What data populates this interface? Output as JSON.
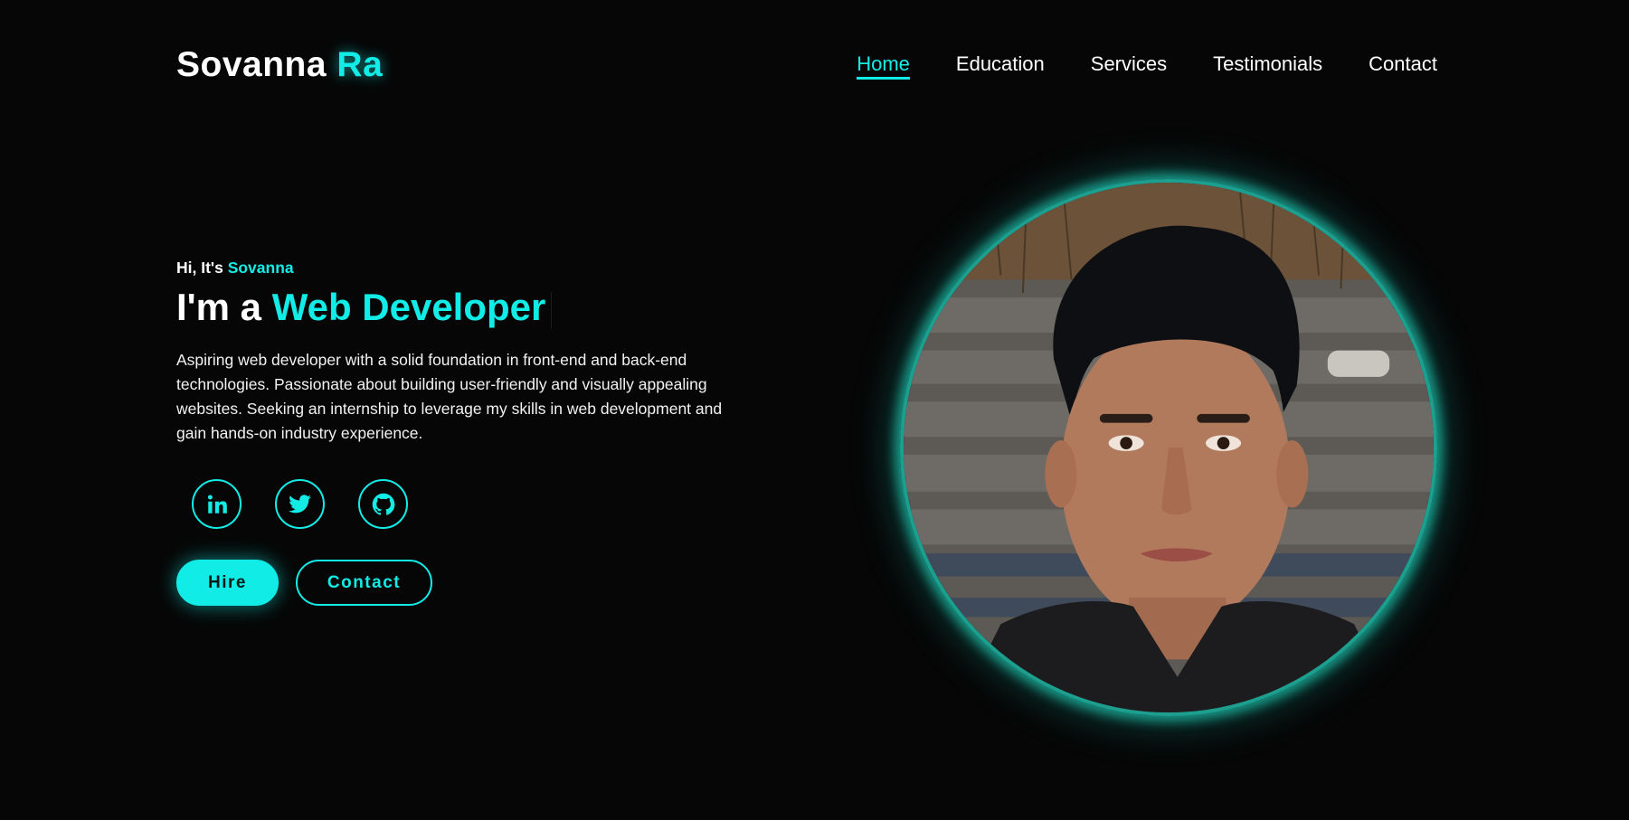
{
  "logo": {
    "first": "Sovanna",
    "accent": "Ra"
  },
  "nav": {
    "items": [
      {
        "label": "Home",
        "active": true
      },
      {
        "label": "Education",
        "active": false
      },
      {
        "label": "Services",
        "active": false
      },
      {
        "label": "Testimonials",
        "active": false
      },
      {
        "label": "Contact",
        "active": false
      }
    ]
  },
  "hero": {
    "greeting_prefix": "Hi, It's",
    "greeting_name": "Sovanna",
    "role_prefix": "I'm a",
    "role_title": "Web Developer",
    "description": "Aspiring web developer with a solid foundation in front-end and back-end technologies. Passionate about building user-friendly and visually appealing websites. Seeking an internship to leverage my skills in web development and gain hands-on industry experience."
  },
  "socials": [
    {
      "icon": "linkedin-icon"
    },
    {
      "icon": "twitter-icon"
    },
    {
      "icon": "github-icon"
    }
  ],
  "buttons": {
    "hire": "Hire",
    "contact": "Contact"
  },
  "colors": {
    "accent": "#12ece7",
    "background": "#060606",
    "text": "#ffffff"
  }
}
